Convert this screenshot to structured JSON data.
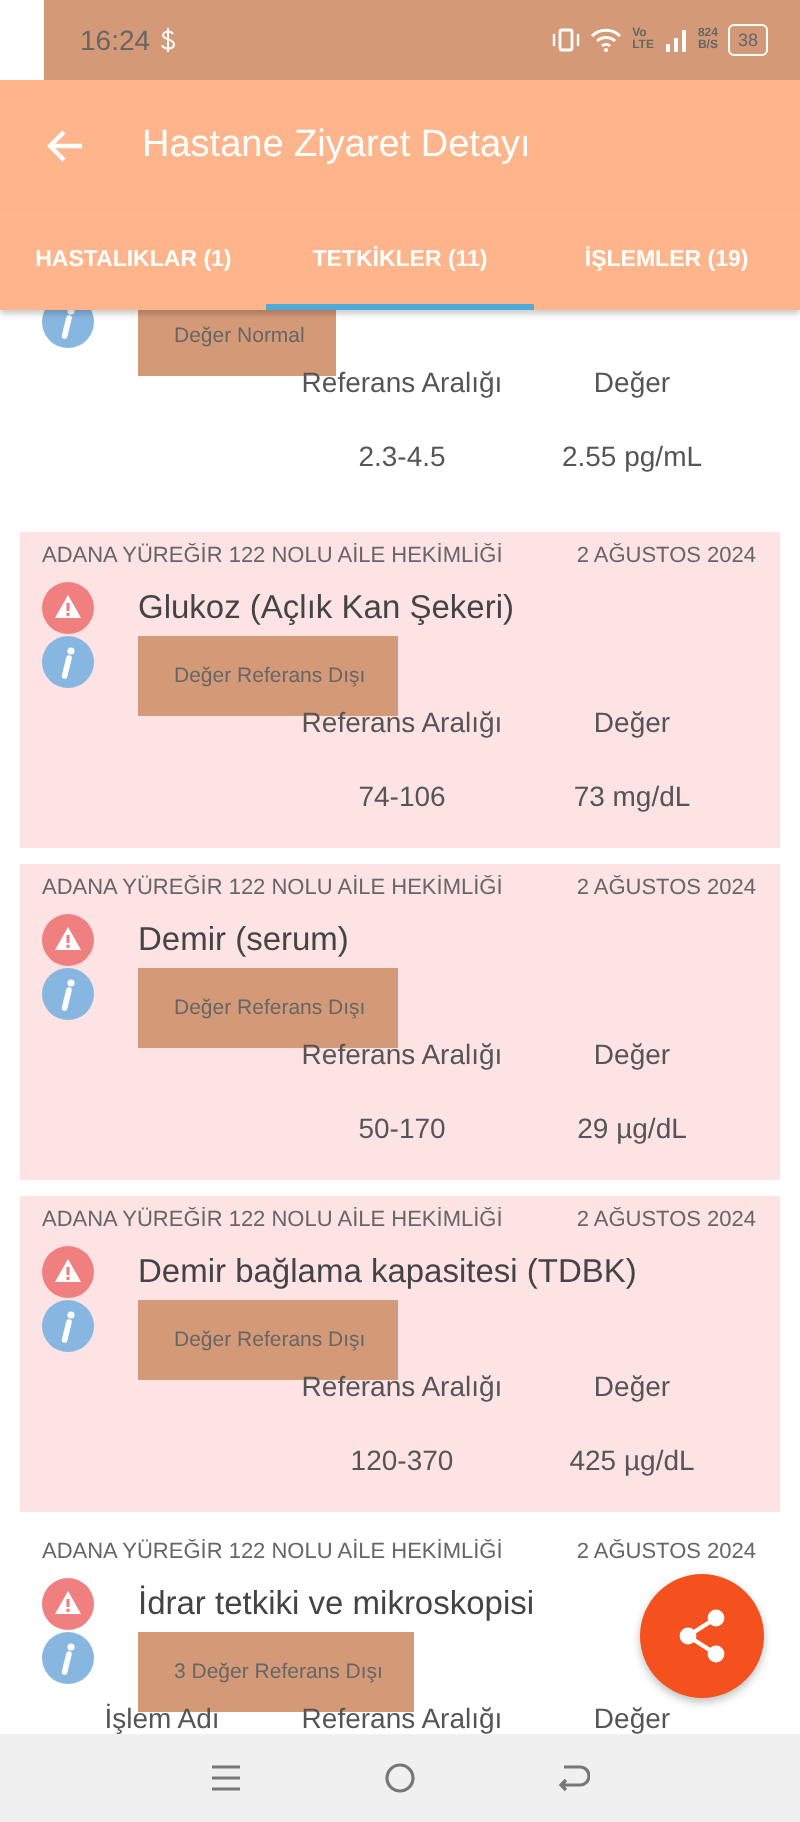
{
  "status_bar": {
    "time": "16:24",
    "network": [
      "Vo",
      "LTE"
    ],
    "speed": [
      "824",
      "B/S"
    ],
    "battery": "38"
  },
  "app_bar": {
    "title": "Hastane Ziyaret Detayı"
  },
  "tabs": [
    {
      "label": "HASTALIKLAR (1)",
      "selected": false
    },
    {
      "label": "TETKİKLER (11)",
      "selected": true
    },
    {
      "label": "İŞLEMLER (19)",
      "selected": false
    }
  ],
  "tests": [
    {
      "highlighted": false,
      "status": "Değer Normal",
      "columns": [
        "Referans Aralığı",
        "Değer"
      ],
      "values": [
        "2.3-4.5",
        "2.55 pg/mL"
      ]
    },
    {
      "highlighted": true,
      "facility": "ADANA YÜREĞİR 122 NOLU AİLE HEKİMLİĞİ",
      "date": "2 AĞUSTOS 2024",
      "name": "Glukoz (Açlık Kan Şekeri)",
      "status": "Değer Referans Dışı",
      "columns": [
        "Referans Aralığı",
        "Değer"
      ],
      "values": [
        "74-106",
        "73 mg/dL"
      ]
    },
    {
      "highlighted": true,
      "facility": "ADANA YÜREĞİR 122 NOLU AİLE HEKİMLİĞİ",
      "date": "2 AĞUSTOS 2024",
      "name": "Demir (serum)",
      "status": "Değer Referans Dışı",
      "columns": [
        "Referans Aralığı",
        "Değer"
      ],
      "values": [
        "50-170",
        "29 µg/dL"
      ]
    },
    {
      "highlighted": true,
      "facility": "ADANA YÜREĞİR 122 NOLU AİLE HEKİMLİĞİ",
      "date": "2 AĞUSTOS 2024",
      "name": "Demir bağlama kapasitesi (TDBK)",
      "status": "Değer Referans Dışı",
      "columns": [
        "Referans Aralığı",
        "Değer"
      ],
      "values": [
        "120-370",
        "425 µg/dL"
      ]
    },
    {
      "highlighted": false,
      "facility": "ADANA YÜREĞİR 122 NOLU AİLE HEKİMLİĞİ",
      "date": "2 AĞUSTOS 2024",
      "name": "İdrar tetkiki ve mikroskopisi",
      "status": "3 Değer Referans Dışı",
      "columns": [
        "İşlem Adı",
        "Referans Aralığı",
        "Değer"
      ]
    }
  ]
}
